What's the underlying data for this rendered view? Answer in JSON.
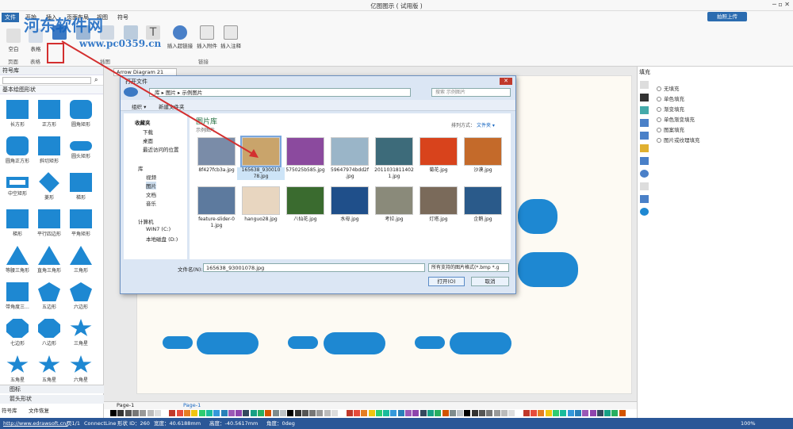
{
  "app": {
    "title": "亿图图示 ( 试用版 )"
  },
  "watermark": {
    "line1": "河东软件网",
    "line2": "www.pc0359.cn"
  },
  "ribbon": {
    "tabs": [
      "文件",
      "开始",
      "插入",
      "页面布局",
      "视图",
      "符号"
    ],
    "upload_label": "拍照上传",
    "buttons": [
      {
        "label": "插入超链接",
        "icon": "hyperlink-icon"
      },
      {
        "label": "插入附件",
        "icon": "attachment-icon"
      },
      {
        "label": "插入注释",
        "icon": "note-icon"
      }
    ],
    "groups": [
      "页面",
      "表格",
      "插图",
      "链接"
    ],
    "left_labels": [
      "空白",
      "表格"
    ]
  },
  "left_panel": {
    "header": "符号库",
    "library": "基本绘图形状",
    "shapes": [
      "长方形",
      "正方形",
      "圆角矩形",
      "圆角正方形",
      "斜切矩形",
      "圆头矩形",
      "中空矩形",
      "菱形",
      "梯形",
      "梯形",
      "平行四边形",
      "平角矩形",
      "等腰三角形",
      "直角三角形",
      "三角形",
      "带角度三...",
      "五边形",
      "六边形",
      "七边形",
      "八边形",
      "三角星",
      "五角星",
      "五角星",
      "六角星"
    ],
    "footer_tabs": [
      "图标",
      "箭头形状"
    ],
    "bottom_tabs": [
      "符号库",
      "文件恢复"
    ]
  },
  "canvas": {
    "tab_title": "Arrow Diagram 21",
    "page_label": "Page-1",
    "page_tab": "Page-1"
  },
  "dialog": {
    "title": "打开文件",
    "path": [
      "库",
      "图片",
      "示例图片"
    ],
    "search_placeholder": "搜索 示例图片",
    "organize": "组织 ▾",
    "new_folder": "新建文件夹",
    "lib_title": "图片库",
    "lib_sub": "示例图片",
    "sort_label": "排列方式：",
    "sort_value": "文件夹 ▾",
    "tree": [
      "收藏夹",
      "下载",
      "桌面",
      "最近访问的位置",
      "库",
      "视频",
      "图片",
      "文档",
      "音乐",
      "计算机",
      "WIN7 (C:)",
      "本地磁盘 (D:)"
    ],
    "files": [
      "8f427fcb3a.jpg",
      "165638_930010 78.jpg",
      "575025b585.jpg",
      "59647974bdd2f .jpg",
      "2011031811402 1.jpg",
      "菊花.jpg",
      "沙漠.jpg",
      "feature-slider-0 1.jpg",
      "hanguo28.jpg",
      "八仙花.jpg",
      "水母.jpg",
      "考拉.jpg",
      "灯塔.jpg",
      "企鹅.jpg"
    ],
    "filename_label": "文件名(N):",
    "filename_value": "165638_93001078.jpg",
    "filter_value": "所有支持的图片格式(*.bmp *.g",
    "open_btn": "打开(O)",
    "cancel_btn": "取消"
  },
  "right_panel": {
    "header": "填充",
    "options": [
      "无填充",
      "单色填充",
      "渐变填充",
      "单色渐变填充",
      "图案填充",
      "图片或纹理填充"
    ]
  },
  "status": {
    "url": "http://www.edrawsoft.cn/",
    "page": "页1/1",
    "shape": "ConnectLine",
    "shape_id": "形状 ID：260",
    "width": "宽度：40.6188mm",
    "height": "高度：-40.5617mm",
    "angle": "角度：0deg",
    "zoom": "100%"
  },
  "colors": {
    "accent": "#1e88d2",
    "tab_blue": "#2b6cb0",
    "arrow_red": "#d32f2f",
    "status_blue": "#2b5797"
  }
}
